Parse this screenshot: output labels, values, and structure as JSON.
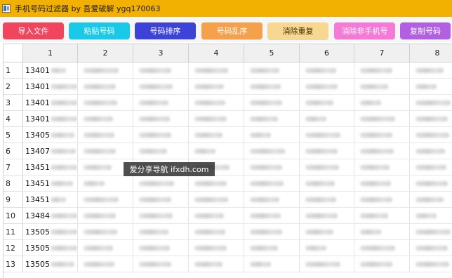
{
  "window": {
    "title": "手机号码过滤器 by 吾爱破解 ygq170063"
  },
  "toolbar": {
    "buttons": [
      {
        "id": "import",
        "label": "导入文件",
        "color": "#f0455d"
      },
      {
        "id": "paste",
        "label": "粘贴号码",
        "color": "#18c9e8"
      },
      {
        "id": "sort",
        "label": "号码排序",
        "color": "#3e43d8"
      },
      {
        "id": "shuffle",
        "label": "号码乱序",
        "color": "#f5a04a"
      },
      {
        "id": "dedupe",
        "label": "消除重复",
        "color": "#f8d890"
      },
      {
        "id": "remove-nonmobile",
        "label": "消除非手机号",
        "color": "#f57ad6"
      },
      {
        "id": "copy",
        "label": "复制号码",
        "color": "#b060e0"
      }
    ]
  },
  "grid": {
    "columns": [
      "1",
      "2",
      "3",
      "4",
      "5",
      "6",
      "7",
      "8"
    ],
    "rows": [
      {
        "num": "1",
        "prefix": "13401"
      },
      {
        "num": "2",
        "prefix": "13401"
      },
      {
        "num": "3",
        "prefix": "13401"
      },
      {
        "num": "4",
        "prefix": "13401"
      },
      {
        "num": "5",
        "prefix": "13405"
      },
      {
        "num": "6",
        "prefix": "13407"
      },
      {
        "num": "7",
        "prefix": "13451"
      },
      {
        "num": "8",
        "prefix": "13451"
      },
      {
        "num": "9",
        "prefix": "13451"
      },
      {
        "num": "10",
        "prefix": "13484"
      },
      {
        "num": "11",
        "prefix": "13505"
      },
      {
        "num": "12",
        "prefix": "13505"
      },
      {
        "num": "13",
        "prefix": "13505"
      }
    ]
  },
  "watermark": {
    "text": "爱分享导航 ifxdh.com"
  }
}
